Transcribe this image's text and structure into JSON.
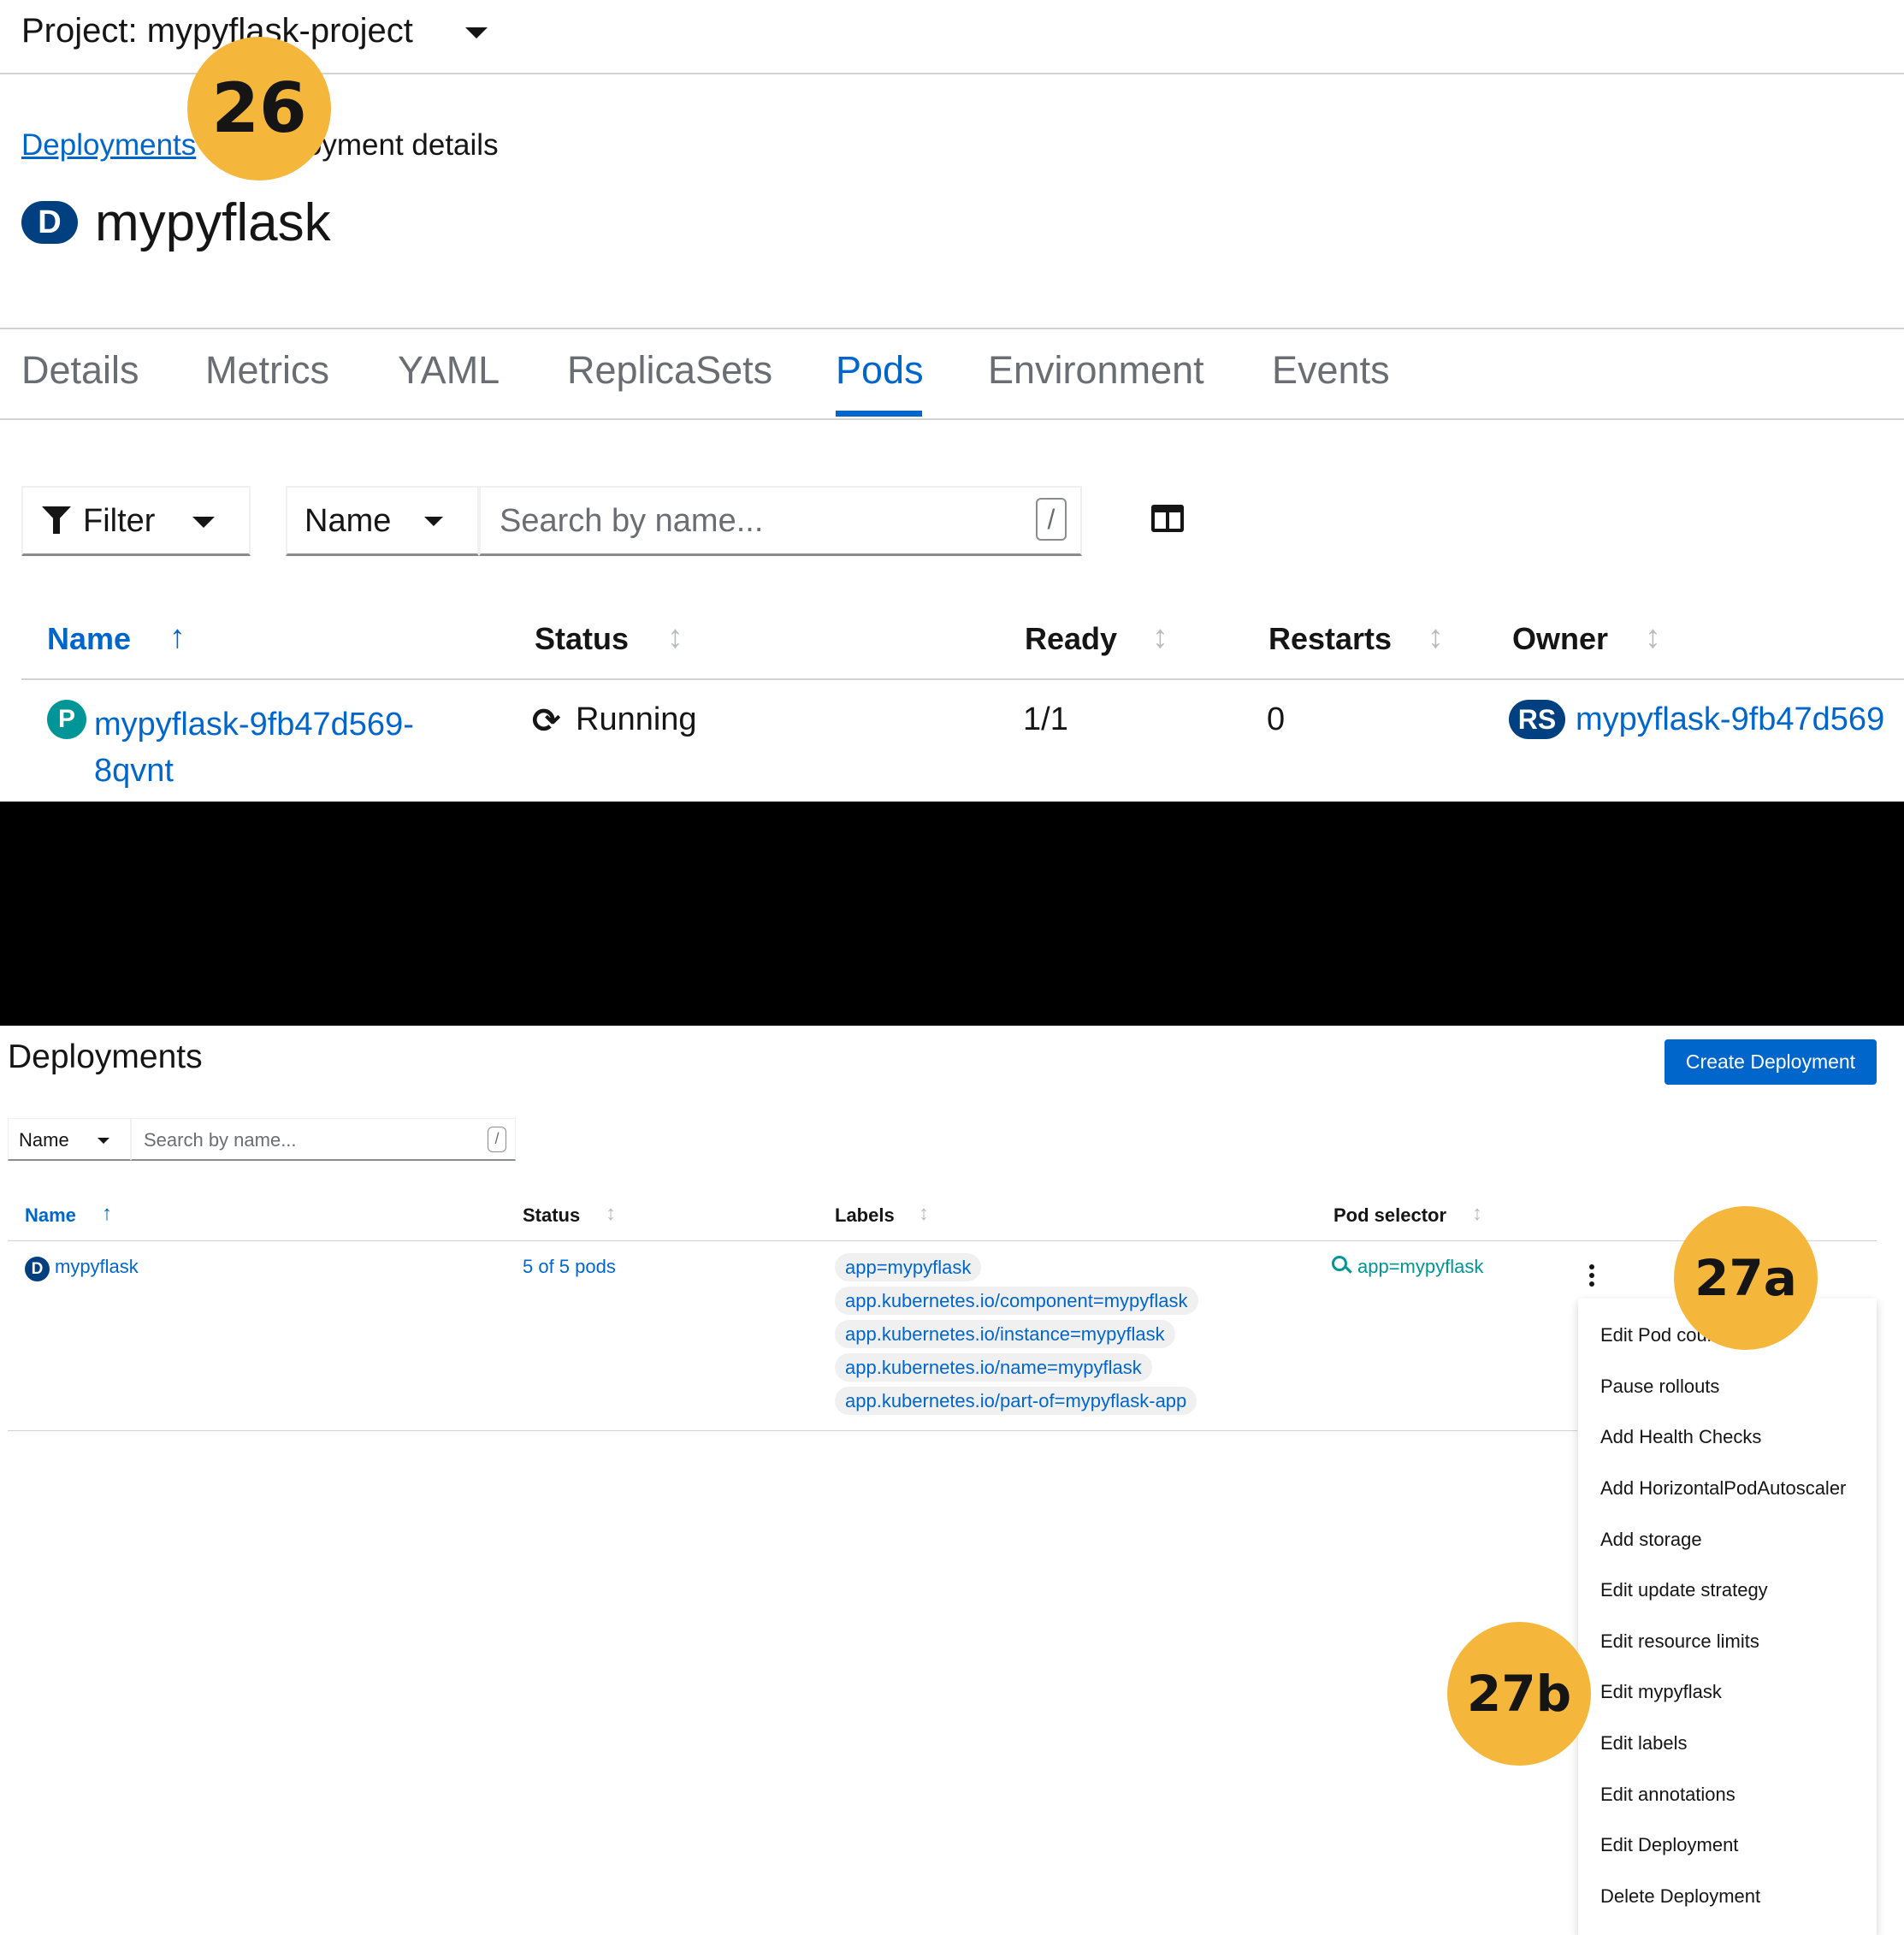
{
  "header": {
    "project_label": "Project: mypyflask-project",
    "breadcrumb_link": "Deployments",
    "breadcrumb_current": "Deployment details",
    "resource_badge": "D",
    "title": "mypyflask"
  },
  "tabs": [
    "Details",
    "Metrics",
    "YAML",
    "ReplicaSets",
    "Pods",
    "Environment",
    "Events"
  ],
  "active_tab": "Pods",
  "pods_toolbar": {
    "filter_label": "Filter",
    "name_select": "Name",
    "search_placeholder": "Search by name...",
    "search_shortcut": "/"
  },
  "pods_table": {
    "headers": [
      "Name",
      "Status",
      "Ready",
      "Restarts",
      "Owner"
    ],
    "rows": [
      {
        "badge": "P",
        "name": "mypyflask-9fb47d569-8qvnt",
        "status": "Running",
        "ready": "1/1",
        "restarts": "0",
        "owner_badge": "RS",
        "owner": "mypyflask-9fb47d569"
      }
    ]
  },
  "deployments": {
    "title": "Deployments",
    "create_button": "Create Deployment",
    "name_select": "Name",
    "search_placeholder": "Search by name...",
    "search_shortcut": "/",
    "headers": [
      "Name",
      "Status",
      "Labels",
      "Pod selector"
    ],
    "rows": [
      {
        "badge": "D",
        "name": "mypyflask",
        "status": "5 of 5 pods",
        "labels": [
          "app=mypyflask",
          "app.kubernetes.io/component=mypyflask",
          "app.kubernetes.io/instance=mypyflask",
          "app.kubernetes.io/name=mypyflask",
          "app.kubernetes.io/part-of=mypyflask-app"
        ],
        "pod_selector": "app=mypyflask"
      }
    ]
  },
  "actions_menu": [
    "Edit Pod count",
    "Pause rollouts",
    "Add Health Checks",
    "Add HorizontalPodAutoscaler",
    "Add storage",
    "Edit update strategy",
    "Edit resource limits",
    "Edit mypyflask",
    "Edit labels",
    "Edit annotations",
    "Edit Deployment",
    "Delete Deployment"
  ],
  "callouts": [
    "26",
    "27a",
    "27b"
  ],
  "colors": {
    "link": "#0066cc",
    "callout": "#f5b73b",
    "deployment_badge": "#004080",
    "pod_badge": "#009596",
    "primary_button": "#0066cc"
  },
  "icons": [
    "caret-down-icon",
    "filter-icon",
    "columns-icon",
    "sort-asc-icon",
    "sort-icon",
    "sync-icon",
    "search-icon",
    "kebab-icon"
  ]
}
